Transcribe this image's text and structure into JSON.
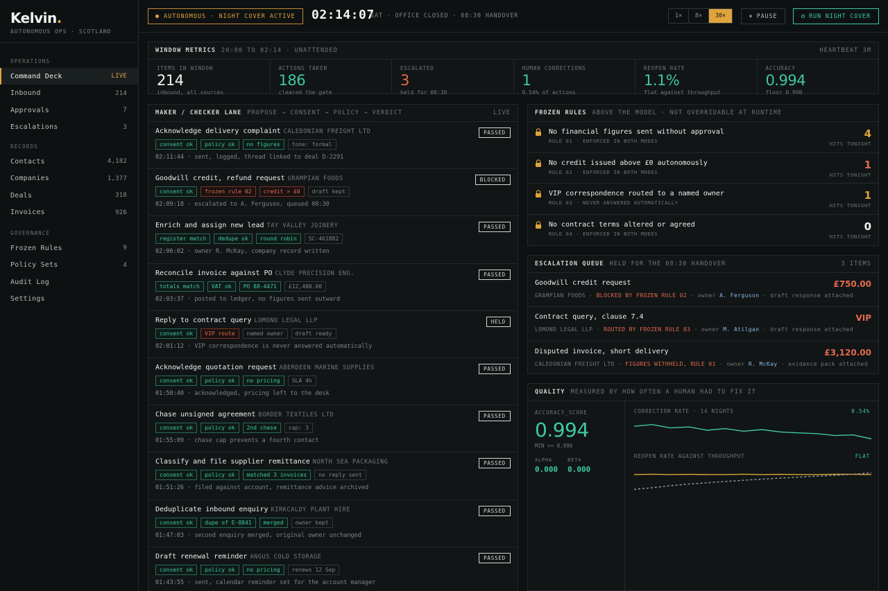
{
  "brand": {
    "name": "Kelvin",
    "dot": ".",
    "subtitle": "AUTONOMOUS OPS · SCOTLAND"
  },
  "sidebar": {
    "sections": [
      {
        "label": "OPERATIONS",
        "items": [
          {
            "label": "Command Deck",
            "count": "LIVE",
            "active": true
          },
          {
            "label": "Inbound",
            "count": "214"
          },
          {
            "label": "Approvals",
            "count": "7"
          },
          {
            "label": "Escalations",
            "count": "3"
          }
        ]
      },
      {
        "label": "RECORDS",
        "items": [
          {
            "label": "Contacts",
            "count": "4,182"
          },
          {
            "label": "Companies",
            "count": "1,377"
          },
          {
            "label": "Deals",
            "count": "318"
          },
          {
            "label": "Invoices",
            "count": "926"
          }
        ]
      },
      {
        "label": "GOVERNANCE",
        "items": [
          {
            "label": "Frozen Rules",
            "count": "9"
          },
          {
            "label": "Policy Sets",
            "count": "4"
          },
          {
            "label": "Audit Log",
            "count": ""
          },
          {
            "label": "Settings",
            "count": ""
          }
        ]
      }
    ]
  },
  "header": {
    "badge": "AUTONOMOUS · NIGHT COVER ACTIVE",
    "clock": "02:14:07",
    "status": "SAT · OFFICE CLOSED · 08:30 HANDOVER",
    "speeds": [
      "1×",
      "8×",
      "30×"
    ],
    "pause": "⏸ PAUSE",
    "run": "RUN NIGHT COVER"
  },
  "metrics": {
    "title": "WINDOW METRICS",
    "sub": "20:00 TO 02:14 · UNATTENDED",
    "right": "HEARTBEAT 3M",
    "items": [
      {
        "label": "ITEMS IN WINDOW",
        "value": "214",
        "sub": "inbound, all sources",
        "color": "#f2f3f1"
      },
      {
        "label": "ACTIONS TAKEN",
        "value": "186",
        "sub": "cleared the gate",
        "color": "#3ec9a0"
      },
      {
        "label": "ESCALATED",
        "value": "3",
        "sub": "held for 08:30",
        "color": "#e36a4c"
      },
      {
        "label": "HUMAN CORRECTIONS",
        "value": "1",
        "sub": "0.54% of actions",
        "color": "#3ec9a0"
      },
      {
        "label": "REOPEN RATE",
        "value": "1.1%",
        "sub": "flat against throughput",
        "color": "#3ec9a0"
      },
      {
        "label": "ACCURACY",
        "value": "0.994",
        "sub": "floor 0.990",
        "color": "#3ec9a0"
      }
    ]
  },
  "lane": {
    "title": "MAKER / CHECKER LANE",
    "sub": "PROPOSE → CONSENT → POLICY → VERDICT",
    "right": "LIVE",
    "cards": [
      {
        "title": "Acknowledge delivery complaint",
        "company": "CALEDONIAN FREIGHT LTD",
        "badge": "PASSED",
        "tags": [
          {
            "t": "consent ok",
            "k": "g"
          },
          {
            "t": "policy ok",
            "k": "g"
          },
          {
            "t": "no figures",
            "k": "g"
          },
          {
            "t": "tone: formal",
            "k": "n"
          }
        ],
        "time": "02:11:44",
        "log": "sent, logged, thread linked to deal D-2291"
      },
      {
        "title": "Goodwill credit, refund request",
        "company": "GRAMPIAN FOODS",
        "badge": "BLOCKED",
        "tags": [
          {
            "t": "consent ok",
            "k": "g"
          },
          {
            "t": "frozen rule 02",
            "k": "r"
          },
          {
            "t": "credit > £0",
            "k": "r"
          },
          {
            "t": "draft kept",
            "k": "n"
          }
        ],
        "time": "02:09:18",
        "log": "escalated to A. Ferguson, queued 08:30"
      },
      {
        "title": "Enrich and assign new lead",
        "company": "TAY VALLEY JOINERY",
        "badge": "PASSED",
        "tags": [
          {
            "t": "register match",
            "k": "g"
          },
          {
            "t": "dedupe ok",
            "k": "g"
          },
          {
            "t": "round robin",
            "k": "g"
          },
          {
            "t": "SC-461882",
            "k": "n"
          }
        ],
        "time": "02:06:02",
        "log": "owner R. McKay, company record written"
      },
      {
        "title": "Reconcile invoice against PO",
        "company": "CLYDE PRECISION ENG.",
        "badge": "PASSED",
        "tags": [
          {
            "t": "totals match",
            "k": "g"
          },
          {
            "t": "VAT ok",
            "k": "g"
          },
          {
            "t": "PO 88-4471",
            "k": "g"
          },
          {
            "t": "£12,480.00",
            "k": "n"
          }
        ],
        "time": "02:03:37",
        "log": "posted to ledger, no figures sent outward"
      },
      {
        "title": "Reply to contract query",
        "company": "LOMOND LEGAL LLP",
        "badge": "HELD",
        "tags": [
          {
            "t": "consent ok",
            "k": "g"
          },
          {
            "t": "VIP route",
            "k": "r"
          },
          {
            "t": "named owner",
            "k": "n"
          },
          {
            "t": "draft ready",
            "k": "n"
          }
        ],
        "time": "02:01:12",
        "log": "VIP correspondence is never answered automatically"
      },
      {
        "title": "Acknowledge quotation request",
        "company": "ABERDEEN MARINE SUPPLIES",
        "badge": "PASSED",
        "tags": [
          {
            "t": "consent ok",
            "k": "g"
          },
          {
            "t": "policy ok",
            "k": "g"
          },
          {
            "t": "no pricing",
            "k": "g"
          },
          {
            "t": "SLA 4h",
            "k": "n"
          }
        ],
        "time": "01:58:40",
        "log": "acknowledged, pricing left to the desk"
      },
      {
        "title": "Chase unsigned agreement",
        "company": "BORDER TEXTILES LTD",
        "badge": "PASSED",
        "tags": [
          {
            "t": "consent ok",
            "k": "g"
          },
          {
            "t": "policy ok",
            "k": "g"
          },
          {
            "t": "2nd chase",
            "k": "g"
          },
          {
            "t": "cap: 3",
            "k": "n"
          }
        ],
        "time": "01:55:09",
        "log": "chase cap prevents a fourth contact"
      },
      {
        "title": "Classify and file supplier remittance",
        "company": "NORTH SEA PACKAGING",
        "badge": "PASSED",
        "tags": [
          {
            "t": "consent ok",
            "k": "g"
          },
          {
            "t": "policy ok",
            "k": "g"
          },
          {
            "t": "matched 3 invoices",
            "k": "g"
          },
          {
            "t": "no reply sent",
            "k": "n"
          }
        ],
        "time": "01:51:26",
        "log": "filed against account, remittance advice archived"
      },
      {
        "title": "Deduplicate inbound enquiry",
        "company": "KIRKCALDY PLANT HIRE",
        "badge": "PASSED",
        "tags": [
          {
            "t": "consent ok",
            "k": "g"
          },
          {
            "t": "dupe of E-8841",
            "k": "g"
          },
          {
            "t": "merged",
            "k": "g"
          },
          {
            "t": "owner kept",
            "k": "n"
          }
        ],
        "time": "01:47:03",
        "log": "second enquiry merged, original owner unchanged"
      },
      {
        "title": "Draft renewal reminder",
        "company": "ANGUS COLD STORAGE",
        "badge": "PASSED",
        "tags": [
          {
            "t": "consent ok",
            "k": "g"
          },
          {
            "t": "policy ok",
            "k": "g"
          },
          {
            "t": "no pricing",
            "k": "g"
          },
          {
            "t": "renews 12 Sep",
            "k": "n"
          }
        ],
        "time": "01:43:55",
        "log": "sent, calendar reminder set for the account manager"
      }
    ]
  },
  "rules": {
    "title": "FROZEN RULES",
    "sub": "ABOVE THE MODEL · NOT OVERRIDABLE AT RUNTIME",
    "items": [
      {
        "text": "No financial figures sent without approval",
        "sub": "RULE 01 · ENFORCED IN BOTH MODES",
        "hits": "4",
        "color": "#e0a43c"
      },
      {
        "text": "No credit issued above £0 autonomously",
        "sub": "RULE 02 · ENFORCED IN BOTH MODES",
        "hits": "1",
        "color": "#e36a4c"
      },
      {
        "text": "VIP correspondence routed to a named owner",
        "sub": "RULE 03 · NEVER ANSWERED AUTOMATICALLY",
        "hits": "1",
        "color": "#e0a43c"
      },
      {
        "text": "No contract terms altered or agreed",
        "sub": "RULE 04 · ENFORCED IN BOTH MODES",
        "hits": "0",
        "color": "#f2f3f1"
      }
    ],
    "hits_label": "HITS TONIGHT"
  },
  "escalation": {
    "title": "ESCALATION QUEUE",
    "sub": "HELD FOR THE 08:30 HANDOVER",
    "right": "3 ITEMS",
    "items": [
      {
        "title": "Goodwill credit request",
        "amount": "£750.00",
        "company": "GRAMPIAN FOODS",
        "reason": "BLOCKED BY FROZEN RULE 02",
        "owner_label": "owner",
        "owner": "A. Ferguson",
        "note": "draft response attached"
      },
      {
        "title": "Contract query, clause 7.4",
        "amount": "VIP",
        "company": "LOMOND LEGAL LLP",
        "reason": "ROUTED BY FROZEN RULE 03",
        "owner_label": "owner",
        "owner": "M. Atilgan",
        "note": "draft response attached"
      },
      {
        "title": "Disputed invoice, short delivery",
        "amount": "£3,120.00",
        "company": "CALEDONIAN FREIGHT LTD",
        "reason": "FIGURES WITHHELD, RULE 01",
        "owner_label": "owner",
        "owner": "R. McKay",
        "note": "evidence pack attached"
      }
    ]
  },
  "quality": {
    "title": "QUALITY",
    "sub": "MEASURED BY HOW OFTEN A HUMAN HAD TO FIX IT",
    "score_label": "ACCURACY_SCORE",
    "score": "0.994",
    "min": "MIN >= 0.990",
    "alpha_label": "ALPHA",
    "alpha": "0.000",
    "beta_label": "BETA",
    "beta": "0.000",
    "chart1_label": "CORRECTION RATE · 14 NIGHTS",
    "chart1_value": "0.54%",
    "chart2_label": "REOPEN RATE AGAINST THROUGHPUT",
    "chart2_value": "FLAT"
  },
  "chart_data": [
    {
      "type": "line",
      "title": "CORRECTION RATE · 14 NIGHTS",
      "series": [
        {
          "values": [
            1.0,
            1.05,
            0.95,
            0.98,
            0.88,
            0.93,
            0.85,
            0.9,
            0.83,
            0.8,
            0.78,
            0.72,
            0.74,
            0.62
          ]
        }
      ],
      "colors": [
        "#3ec9a0"
      ]
    },
    {
      "type": "line",
      "title": "REOPEN RATE AGAINST THROUGHPUT",
      "series": [
        {
          "values": [
            1.1,
            1.12,
            1.1,
            1.11,
            1.1,
            1.1,
            1.12,
            1.1,
            1.11,
            1.1,
            1.1,
            1.12,
            1.11,
            1.1
          ]
        },
        {
          "values": [
            0.2,
            0.3,
            0.42,
            0.52,
            0.6,
            0.68,
            0.75,
            0.82,
            0.88,
            0.94,
            1.0,
            1.05,
            1.12,
            1.2
          ]
        }
      ],
      "colors": [
        "#e0a43c",
        "#9aa09e"
      ]
    }
  ]
}
